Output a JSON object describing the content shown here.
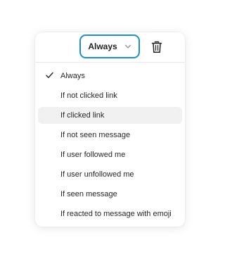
{
  "select": {
    "value": "Always",
    "icon": "chevron-down-icon"
  },
  "actions": {
    "delete_icon": "trash-icon"
  },
  "menu": {
    "selected_index": 0,
    "hovered_index": 2,
    "items": [
      {
        "label": "Always",
        "checked": true
      },
      {
        "label": "If not clicked link",
        "checked": false
      },
      {
        "label": "If clicked link",
        "checked": false
      },
      {
        "label": "If not seen message",
        "checked": false
      },
      {
        "label": "If user followed me",
        "checked": false
      },
      {
        "label": "If user unfollowed me",
        "checked": false
      },
      {
        "label": "If seen message",
        "checked": false
      },
      {
        "label": "If reacted to message with emoji",
        "checked": false
      }
    ]
  },
  "colors": {
    "focus_border": "#1d8fd1",
    "hover_bg": "#f1f1f2",
    "text": "#26262b"
  }
}
